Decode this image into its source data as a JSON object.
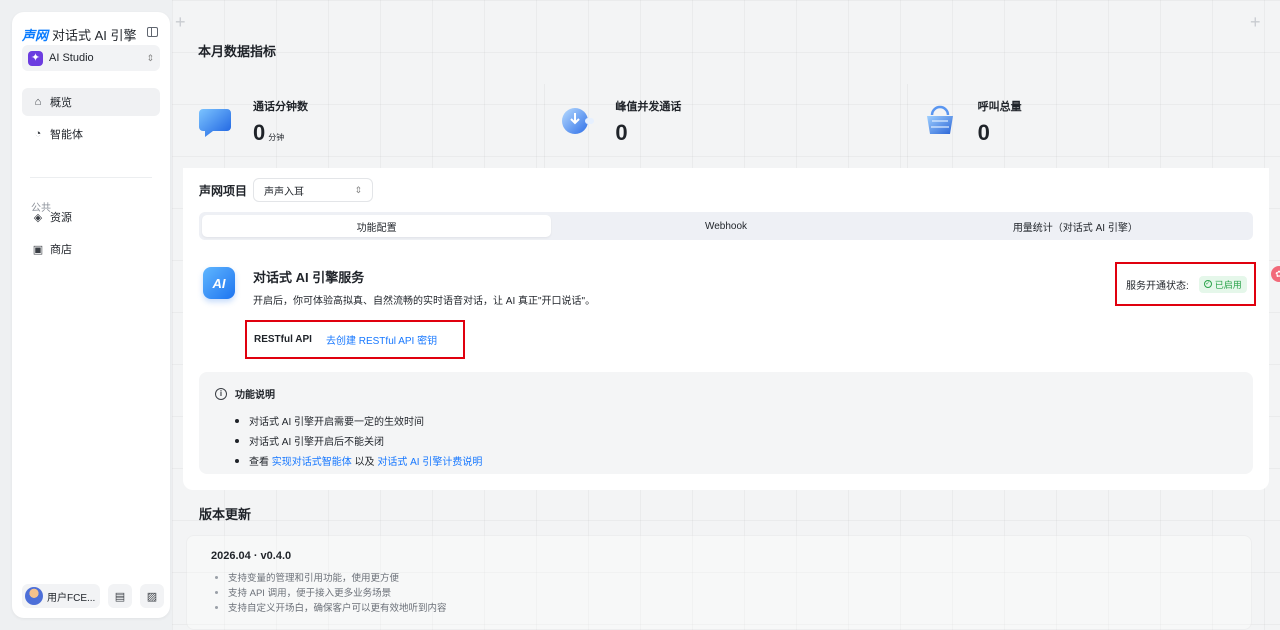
{
  "sidebar": {
    "brand_logo": "声网",
    "brand_name": "对话式 AI 引擎",
    "workspace": {
      "icon": "sparkle-icon",
      "label": "AI Studio"
    },
    "nav_items": [
      {
        "label": "概览",
        "icon": "home-icon",
        "active": true
      },
      {
        "label": "智能体",
        "icon": "agent-icon",
        "active": false
      }
    ],
    "section_label": "公共",
    "public_items": [
      {
        "label": "资源",
        "icon": "layers-icon"
      },
      {
        "label": "商店",
        "icon": "store-icon"
      }
    ],
    "user_name": "用户FCE..."
  },
  "metrics": {
    "title": "本月数据指标",
    "items": [
      {
        "label": "通话分钟数",
        "value": "0",
        "unit": "分钟",
        "icon": "chat-bubble-icon"
      },
      {
        "label": "峰值并发通话",
        "value": "0",
        "unit": "",
        "icon": "call-peak-icon"
      },
      {
        "label": "呼叫总量",
        "value": "0",
        "unit": "",
        "icon": "basket-icon"
      }
    ]
  },
  "project": {
    "label": "声网项目",
    "selected": "声声入耳"
  },
  "tabs": [
    {
      "label": "功能配置",
      "active": true
    },
    {
      "label": "Webhook",
      "active": false
    },
    {
      "label": "用量统计（对话式 AI 引擎）",
      "active": false
    }
  ],
  "service": {
    "icon_text": "AI",
    "title": "对话式 AI 引擎服务",
    "description": "开启后，你可体验高拟真、自然流畅的实时语音对话，让 AI 真正\"开口说话\"。",
    "status_label": "服务开通状态:",
    "status_badge": "已启用",
    "status_color": "#2aa34a",
    "api_label": "RESTful API",
    "api_link": "去创建 RESTful API 密钥"
  },
  "info": {
    "title": "功能说明",
    "items": [
      "对话式 AI 引擎开启需要一定的生效时间",
      "对话式 AI 引擎开启后不能关闭"
    ],
    "view_prefix": "查看",
    "view_link1": "实现对话式智能体",
    "view_middle": "以及",
    "view_link2": "对话式 AI 引擎计费说明"
  },
  "release": {
    "title": "版本更新",
    "version": "2026.04 · v0.4.0",
    "items": [
      "支持变量的管理和引用功能，使用更方便",
      "支持 API 调用，便于接入更多业务场景",
      "支持自定义开场白，确保客户可以更有效地听到内容"
    ]
  },
  "colors": {
    "accent": "#1677ff",
    "highlight_border": "#e0000e"
  }
}
